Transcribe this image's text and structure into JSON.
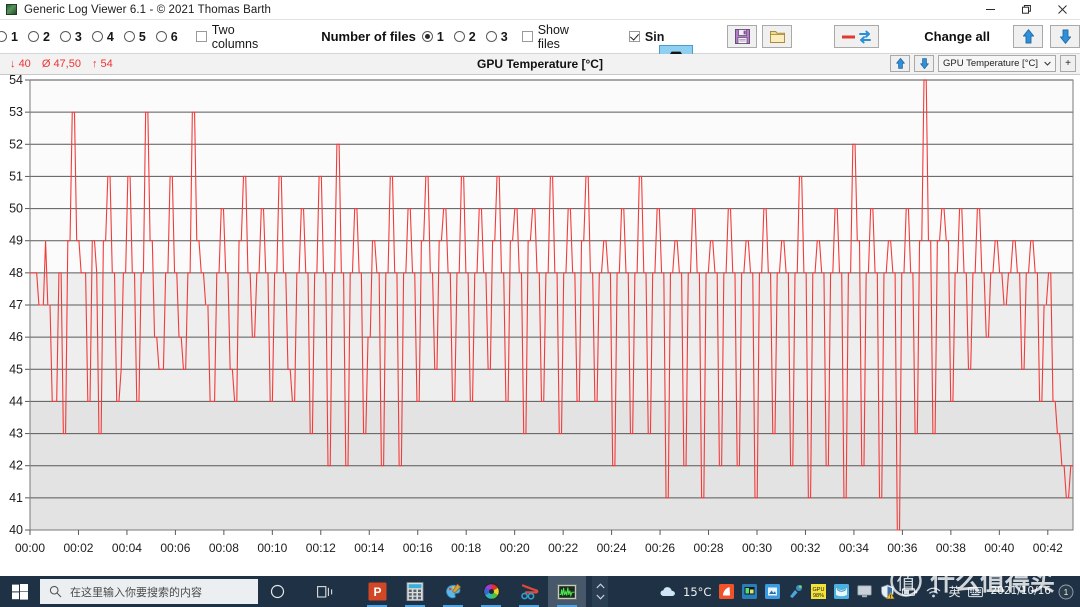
{
  "window": {
    "title": "Generic Log Viewer 6.1 - © 2021 Thomas Barth",
    "app_icon": "chart-app-icon",
    "minimize_label": "minimize-icon",
    "restore_label": "restore-icon",
    "close_label": "close-icon"
  },
  "toolbar": {
    "column_radios": [
      {
        "label": "1",
        "selected": false
      },
      {
        "label": "2",
        "selected": false
      },
      {
        "label": "3",
        "selected": false
      },
      {
        "label": "4",
        "selected": false
      },
      {
        "label": "5",
        "selected": false
      },
      {
        "label": "6",
        "selected": false
      }
    ],
    "two_columns": {
      "label": "Two columns",
      "checked": false
    },
    "number_of_files_label": "Number of files",
    "file_radios": [
      {
        "label": "1",
        "selected": true
      },
      {
        "label": "2",
        "selected": false
      },
      {
        "label": "3",
        "selected": false
      }
    ],
    "show_files": {
      "label": "Show files",
      "checked": false
    },
    "single_label": "Sin",
    "single_checked": true,
    "camera_button": "camera-icon",
    "save_button": "save-icon",
    "open_button": "folder-open-icon",
    "reset_button": "reset-swap-icon",
    "change_all_label": "Change all",
    "move_up_button": "arrow-up-icon",
    "move_down_button": "arrow-down-icon"
  },
  "chart_header": {
    "min_label": "40",
    "avg_label": "47,50",
    "max_label": "54",
    "min_symbol": "↓",
    "avg_symbol": "Ø",
    "max_symbol": "↑",
    "title": "GPU Temperature [°C]",
    "up_button": "arrow-up-icon",
    "down_button": "arrow-down-icon",
    "series_select": "GPU Temperature [°C]",
    "add_button": "+"
  },
  "chart_data": {
    "type": "line",
    "title": "GPU Temperature [°C]",
    "xlabel": "",
    "ylabel": "GPU Temperature [°C]",
    "series_name": "GPU Temperature [°C]",
    "line_color": "#f23b3b",
    "grid": true,
    "legend": false,
    "ylim": [
      40,
      54
    ],
    "yticks": [
      40,
      41,
      42,
      43,
      44,
      45,
      46,
      47,
      48,
      49,
      50,
      51,
      52,
      53,
      54
    ],
    "xlim": [
      "00:00",
      "00:43"
    ],
    "xticks": [
      "00:00",
      "00:02",
      "00:04",
      "00:06",
      "00:08",
      "00:10",
      "00:12",
      "00:14",
      "00:16",
      "00:18",
      "00:20",
      "00:22",
      "00:24",
      "00:26",
      "00:28",
      "00:30",
      "00:32",
      "00:34",
      "00:36",
      "00:38",
      "00:40",
      "00:42"
    ],
    "stats": {
      "min": 40,
      "avg": 47.5,
      "max": 54
    },
    "sample_interval_seconds": 5,
    "values": [
      48,
      48,
      48,
      48,
      47,
      47,
      47,
      49,
      47,
      47,
      44,
      44,
      44,
      48,
      48,
      43,
      43,
      49,
      49,
      53,
      53,
      49,
      49,
      48,
      48,
      48,
      44,
      44,
      49,
      49,
      48,
      43,
      43,
      49,
      49,
      51,
      51,
      48,
      48,
      44,
      44,
      45,
      48,
      48,
      51,
      51,
      48,
      48,
      44,
      44,
      48,
      48,
      53,
      53,
      49,
      49,
      46,
      46,
      45,
      45,
      45,
      48,
      48,
      51,
      51,
      48,
      48,
      46,
      46,
      45,
      45,
      48,
      48,
      53,
      53,
      49,
      49,
      48,
      48,
      47,
      47,
      44,
      44,
      44,
      48,
      48,
      50,
      50,
      48,
      48,
      45,
      45,
      44,
      44,
      49,
      49,
      51,
      51,
      48,
      48,
      46,
      46,
      48,
      48,
      50,
      50,
      48,
      48,
      44,
      44,
      48,
      48,
      51,
      51,
      48,
      48,
      45,
      45,
      44,
      44,
      48,
      48,
      50,
      50,
      48,
      48,
      43,
      43,
      48,
      48,
      51,
      51,
      48,
      48,
      42,
      42,
      48,
      48,
      52,
      52,
      48,
      48,
      42,
      42,
      48,
      48,
      50,
      50,
      48,
      48,
      43,
      43,
      46,
      46,
      49,
      49,
      48,
      48,
      42,
      42,
      48,
      48,
      51,
      51,
      48,
      48,
      42,
      42,
      48,
      48,
      50,
      50,
      48,
      48,
      44,
      44,
      49,
      49,
      51,
      51,
      48,
      48,
      45,
      45,
      49,
      49,
      50,
      50,
      48,
      48,
      44,
      44,
      48,
      48,
      51,
      51,
      48,
      48,
      44,
      44,
      48,
      48,
      50,
      50,
      48,
      48,
      45,
      45,
      49,
      49,
      51,
      51,
      48,
      48,
      44,
      44,
      49,
      49,
      50,
      50,
      48,
      48,
      43,
      43,
      49,
      49,
      50,
      50,
      48,
      48,
      44,
      44,
      48,
      48,
      51,
      51,
      48,
      48,
      43,
      43,
      48,
      48,
      50,
      50,
      48,
      48,
      44,
      44,
      49,
      49,
      51,
      51,
      48,
      48,
      44,
      44,
      48,
      48,
      49,
      49,
      48,
      48,
      42,
      42,
      48,
      48,
      50,
      50,
      48,
      48,
      43,
      43,
      48,
      48,
      51,
      51,
      48,
      48,
      43,
      43,
      48,
      48,
      50,
      50,
      48,
      48,
      41,
      41,
      48,
      48,
      49,
      49,
      48,
      48,
      42,
      42,
      48,
      48,
      50,
      50,
      48,
      48,
      41,
      41,
      48,
      48,
      49,
      49,
      48,
      48,
      42,
      42,
      48,
      48,
      50,
      50,
      48,
      48,
      42,
      42,
      48,
      48,
      49,
      49,
      48,
      48,
      41,
      41,
      48,
      48,
      50,
      50,
      48,
      48,
      43,
      43,
      48,
      48,
      49,
      49,
      48,
      48,
      42,
      42,
      48,
      48,
      51,
      51,
      48,
      48,
      41,
      41,
      48,
      48,
      49,
      49,
      48,
      48,
      42,
      42,
      48,
      48,
      50,
      50,
      48,
      48,
      41,
      41,
      48,
      48,
      52,
      52,
      49,
      49,
      42,
      42,
      48,
      48,
      50,
      50,
      48,
      48,
      41,
      41,
      48,
      48,
      49,
      49,
      48,
      48,
      40,
      40,
      48,
      48,
      50,
      50,
      48,
      48,
      43,
      43,
      49,
      49,
      54,
      54,
      49,
      49,
      43,
      43,
      49,
      49,
      50,
      50,
      49,
      49,
      44,
      44,
      48,
      48,
      50,
      50,
      48,
      48,
      45,
      45,
      48,
      48,
      50,
      50,
      48,
      48,
      46,
      46,
      48,
      48,
      49,
      49,
      48,
      48,
      47,
      47,
      48,
      48,
      49,
      49,
      48,
      48,
      45,
      45,
      48,
      48,
      49,
      49,
      48,
      48,
      44,
      44,
      47,
      47,
      48,
      48,
      44,
      44,
      43,
      43,
      42,
      42,
      41,
      41,
      42,
      42
    ]
  },
  "taskbar": {
    "start_button": "windows-start-icon",
    "search_placeholder": "在这里输入你要搜索的内容",
    "search_icon": "search-icon",
    "cortana_icon": "cortana-circle-icon",
    "taskview_icon": "task-view-icon",
    "apps": [
      {
        "name": "powerpoint-icon",
        "running": true
      },
      {
        "name": "calculator-icon",
        "running": true
      },
      {
        "name": "paint-icon",
        "running": true
      },
      {
        "name": "color-wheel-icon",
        "running": true
      },
      {
        "name": "snipping-tool-icon",
        "running": true
      },
      {
        "name": "log-viewer-icon",
        "running": true,
        "active": true
      }
    ],
    "weather_icon": "cloud-icon",
    "weather_temp": "15°C",
    "tray_icons": [
      "flame-icon",
      "monitor-icon",
      "blue-app-icon",
      "cleaner-icon",
      "gpu-icon",
      "shield-blue-icon",
      "display-icon",
      "security-warning-icon",
      "battery-icon",
      "network-icon"
    ],
    "ime_label": "英",
    "ime_keyboard": "keyboard-icon",
    "clock_date": "2021/10/16",
    "notification_count": "1"
  },
  "watermark": {
    "logo": "值",
    "text": "什么值得买"
  }
}
